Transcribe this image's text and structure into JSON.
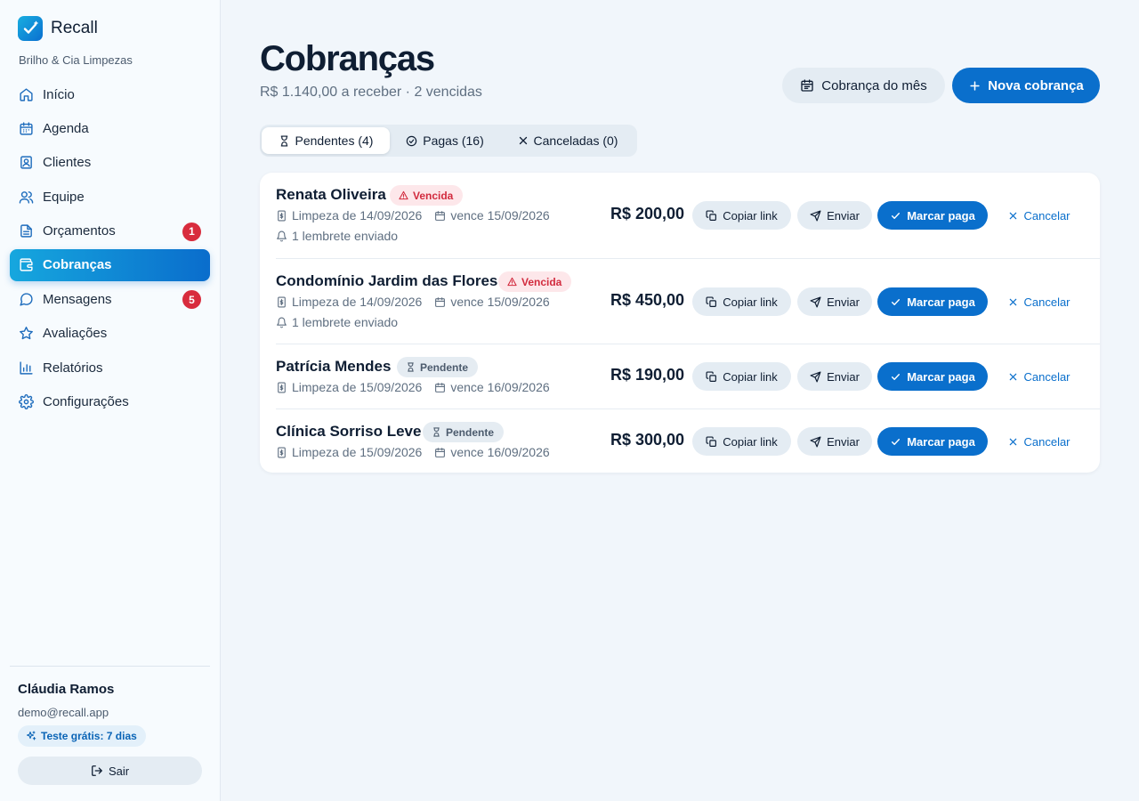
{
  "app": {
    "name": "Recall",
    "company": "Brilho & Cia Limpezas"
  },
  "nav": [
    {
      "label": "Início",
      "icon": "home-icon"
    },
    {
      "label": "Agenda",
      "icon": "calendar-icon"
    },
    {
      "label": "Clientes",
      "icon": "contact-card-icon"
    },
    {
      "label": "Equipe",
      "icon": "users-icon"
    },
    {
      "label": "Orçamentos",
      "icon": "document-icon",
      "badge": "1"
    },
    {
      "label": "Cobranças",
      "icon": "wallet-icon",
      "active": true
    },
    {
      "label": "Mensagens",
      "icon": "message-circle-icon",
      "badge": "5"
    },
    {
      "label": "Avaliações",
      "icon": "star-icon"
    },
    {
      "label": "Relatórios",
      "icon": "bar-chart-icon"
    },
    {
      "label": "Configurações",
      "icon": "gear-icon"
    }
  ],
  "user": {
    "name": "Cláudia Ramos",
    "email": "demo@recall.app",
    "trial": "Teste grátis: 7 dias",
    "logout": "Sair"
  },
  "page": {
    "title": "Cobranças",
    "subtitle": "R$ 1.140,00 a receber · 2 vencidas",
    "month_button": "Cobrança do mês",
    "new_button": "Nova cobrança"
  },
  "tabs": [
    {
      "label": "Pendentes (4)",
      "icon": "hourglass-icon",
      "active": true
    },
    {
      "label": "Pagas (16)",
      "icon": "check-circle-icon"
    },
    {
      "label": "Canceladas (0)",
      "icon": "close-icon"
    }
  ],
  "actions": {
    "copy": "Copiar link",
    "send": "Enviar",
    "paid": "Marcar paga",
    "cancel": "Cancelar"
  },
  "invoices": [
    {
      "name": "Renata Oliveira",
      "status": "Vencida",
      "status_type": "overdue",
      "service": "Limpeza de 14/09/2026",
      "due": "vence 15/09/2026",
      "reminder": "1 lembrete enviado",
      "amount": "R$ 200,00"
    },
    {
      "name": "Condomínio Jardim das Flores",
      "status": "Vencida",
      "status_type": "overdue",
      "service": "Limpeza de 14/09/2026",
      "due": "vence 15/09/2026",
      "reminder": "1 lembrete enviado",
      "amount": "R$ 450,00"
    },
    {
      "name": "Patrícia Mendes",
      "status": "Pendente",
      "status_type": "pending",
      "service": "Limpeza de 15/09/2026",
      "due": "vence 16/09/2026",
      "amount": "R$ 190,00"
    },
    {
      "name": "Clínica Sorriso Leve",
      "status": "Pendente",
      "status_type": "pending",
      "service": "Limpeza de 15/09/2026",
      "due": "vence 16/09/2026",
      "amount": "R$ 300,00"
    }
  ],
  "colors": {
    "primary": "#0a6fcc",
    "overdue": "#d22b3e",
    "badge": "#d82c3d"
  }
}
